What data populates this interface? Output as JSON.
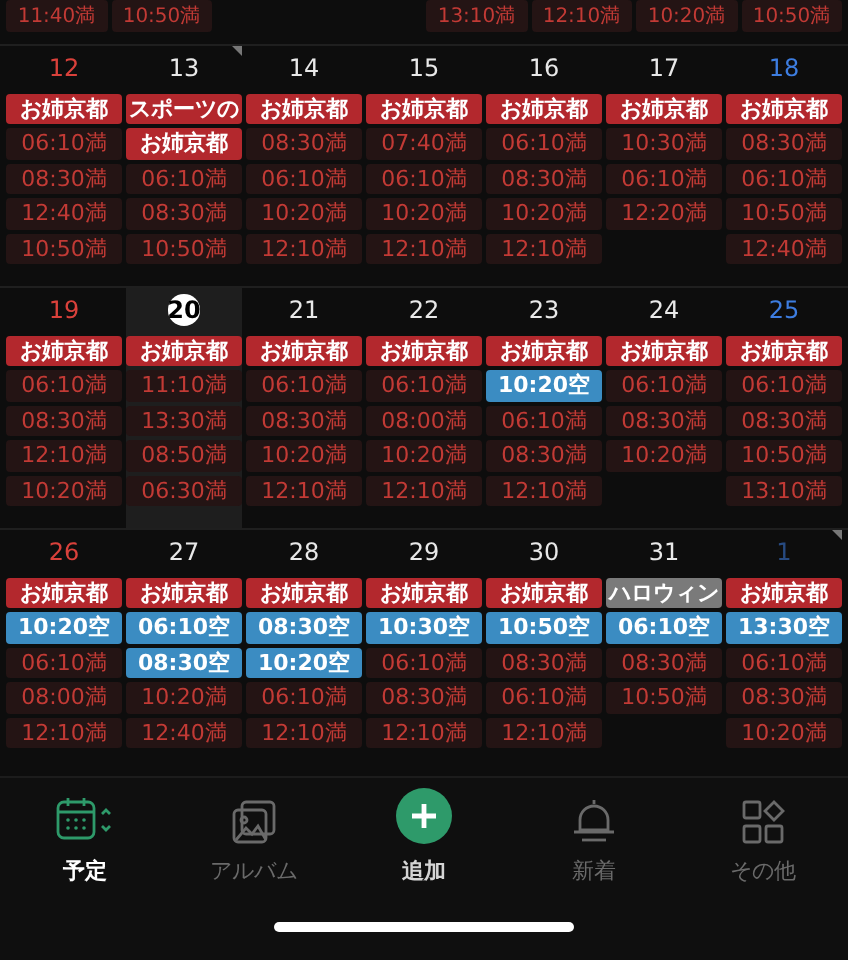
{
  "partial_row": [
    {
      "kind": "full",
      "text": "11:40満"
    },
    {
      "kind": "full",
      "text": "10:50満"
    },
    {
      "kind": "blank"
    },
    {
      "kind": "blank"
    },
    {
      "kind": "full",
      "text": "13:10満"
    },
    {
      "kind": "full",
      "text": "12:10満"
    },
    {
      "kind": "full",
      "text": "10:20満"
    },
    {
      "kind": "full",
      "text": "10:50満"
    }
  ],
  "weeks": [
    {
      "days": [
        {
          "day": "12",
          "kind": "sun",
          "today": false,
          "marked": false,
          "other_month": false,
          "chips": [
            {
              "kind": "event",
              "text": "お姉京都"
            },
            {
              "kind": "full",
              "text": "06:10満"
            },
            {
              "kind": "full",
              "text": "08:30満"
            },
            {
              "kind": "full",
              "text": "12:40満"
            },
            {
              "kind": "full",
              "text": "10:50満"
            }
          ]
        },
        {
          "day": "13",
          "kind": "weekday",
          "today": false,
          "marked": true,
          "other_month": false,
          "chips": [
            {
              "kind": "event",
              "text": "スポーツの"
            },
            {
              "kind": "event",
              "text": "お姉京都"
            },
            {
              "kind": "full",
              "text": "06:10満"
            },
            {
              "kind": "full",
              "text": "08:30満"
            },
            {
              "kind": "full",
              "text": "10:50満"
            }
          ]
        },
        {
          "day": "14",
          "kind": "weekday",
          "today": false,
          "marked": false,
          "other_month": false,
          "chips": [
            {
              "kind": "event",
              "text": "お姉京都"
            },
            {
              "kind": "full",
              "text": "08:30満"
            },
            {
              "kind": "full",
              "text": "06:10満"
            },
            {
              "kind": "full",
              "text": "10:20満"
            },
            {
              "kind": "full",
              "text": "12:10満"
            }
          ]
        },
        {
          "day": "15",
          "kind": "weekday",
          "today": false,
          "marked": false,
          "other_month": false,
          "chips": [
            {
              "kind": "event",
              "text": "お姉京都"
            },
            {
              "kind": "full",
              "text": "07:40満"
            },
            {
              "kind": "full",
              "text": "06:10満"
            },
            {
              "kind": "full",
              "text": "10:20満"
            },
            {
              "kind": "full",
              "text": "12:10満"
            }
          ]
        },
        {
          "day": "16",
          "kind": "weekday",
          "today": false,
          "marked": false,
          "other_month": false,
          "chips": [
            {
              "kind": "event",
              "text": "お姉京都"
            },
            {
              "kind": "full",
              "text": "06:10満"
            },
            {
              "kind": "full",
              "text": "08:30満"
            },
            {
              "kind": "full",
              "text": "10:20満"
            },
            {
              "kind": "full",
              "text": "12:10満"
            }
          ]
        },
        {
          "day": "17",
          "kind": "weekday",
          "today": false,
          "marked": false,
          "other_month": false,
          "chips": [
            {
              "kind": "event",
              "text": "お姉京都"
            },
            {
              "kind": "full",
              "text": "10:30満"
            },
            {
              "kind": "full",
              "text": "06:10満"
            },
            {
              "kind": "full",
              "text": "12:20満"
            }
          ]
        },
        {
          "day": "18",
          "kind": "sat",
          "today": false,
          "marked": false,
          "other_month": false,
          "chips": [
            {
              "kind": "event",
              "text": "お姉京都"
            },
            {
              "kind": "full",
              "text": "08:30満"
            },
            {
              "kind": "full",
              "text": "06:10満"
            },
            {
              "kind": "full",
              "text": "10:50満"
            },
            {
              "kind": "full",
              "text": "12:40満"
            }
          ]
        }
      ]
    },
    {
      "days": [
        {
          "day": "19",
          "kind": "sun",
          "today": false,
          "marked": false,
          "other_month": false,
          "chips": [
            {
              "kind": "event",
              "text": "お姉京都"
            },
            {
              "kind": "full",
              "text": "06:10満"
            },
            {
              "kind": "full",
              "text": "08:30満"
            },
            {
              "kind": "full",
              "text": "12:10満"
            },
            {
              "kind": "full",
              "text": "10:20満"
            }
          ]
        },
        {
          "day": "20",
          "kind": "weekday",
          "today": true,
          "marked": false,
          "other_month": false,
          "chips": [
            {
              "kind": "event",
              "text": "お姉京都"
            },
            {
              "kind": "full",
              "text": "11:10満"
            },
            {
              "kind": "full",
              "text": "13:30満"
            },
            {
              "kind": "full",
              "text": "08:50満"
            },
            {
              "kind": "full",
              "text": "06:30満"
            }
          ]
        },
        {
          "day": "21",
          "kind": "weekday",
          "today": false,
          "marked": false,
          "other_month": false,
          "chips": [
            {
              "kind": "event",
              "text": "お姉京都"
            },
            {
              "kind": "full",
              "text": "06:10満"
            },
            {
              "kind": "full",
              "text": "08:30満"
            },
            {
              "kind": "full",
              "text": "10:20満"
            },
            {
              "kind": "full",
              "text": "12:10満"
            }
          ]
        },
        {
          "day": "22",
          "kind": "weekday",
          "today": false,
          "marked": false,
          "other_month": false,
          "chips": [
            {
              "kind": "event",
              "text": "お姉京都"
            },
            {
              "kind": "full",
              "text": "06:10満"
            },
            {
              "kind": "full",
              "text": "08:00満"
            },
            {
              "kind": "full",
              "text": "10:20満"
            },
            {
              "kind": "full",
              "text": "12:10満"
            }
          ]
        },
        {
          "day": "23",
          "kind": "weekday",
          "today": false,
          "marked": false,
          "other_month": false,
          "chips": [
            {
              "kind": "event",
              "text": "お姉京都"
            },
            {
              "kind": "vacant",
              "text": "10:20空"
            },
            {
              "kind": "full",
              "text": "06:10満"
            },
            {
              "kind": "full",
              "text": "08:30満"
            },
            {
              "kind": "full",
              "text": "12:10満"
            }
          ]
        },
        {
          "day": "24",
          "kind": "weekday",
          "today": false,
          "marked": false,
          "other_month": false,
          "chips": [
            {
              "kind": "event",
              "text": "お姉京都"
            },
            {
              "kind": "full",
              "text": "06:10満"
            },
            {
              "kind": "full",
              "text": "08:30満"
            },
            {
              "kind": "full",
              "text": "10:20満"
            }
          ]
        },
        {
          "day": "25",
          "kind": "sat",
          "today": false,
          "marked": false,
          "other_month": false,
          "chips": [
            {
              "kind": "event",
              "text": "お姉京都"
            },
            {
              "kind": "full",
              "text": "06:10満"
            },
            {
              "kind": "full",
              "text": "08:30満"
            },
            {
              "kind": "full",
              "text": "10:50満"
            },
            {
              "kind": "full",
              "text": "13:10満"
            }
          ]
        }
      ]
    },
    {
      "days": [
        {
          "day": "26",
          "kind": "sun",
          "today": false,
          "marked": false,
          "other_month": false,
          "chips": [
            {
              "kind": "event",
              "text": "お姉京都"
            },
            {
              "kind": "vacant",
              "text": "10:20空"
            },
            {
              "kind": "full",
              "text": "06:10満"
            },
            {
              "kind": "full",
              "text": "08:00満"
            },
            {
              "kind": "full",
              "text": "12:10満"
            }
          ]
        },
        {
          "day": "27",
          "kind": "weekday",
          "today": false,
          "marked": false,
          "other_month": false,
          "chips": [
            {
              "kind": "event",
              "text": "お姉京都"
            },
            {
              "kind": "vacant",
              "text": "06:10空"
            },
            {
              "kind": "vacant",
              "text": "08:30空"
            },
            {
              "kind": "full",
              "text": "10:20満"
            },
            {
              "kind": "full",
              "text": "12:40満"
            }
          ]
        },
        {
          "day": "28",
          "kind": "weekday",
          "today": false,
          "marked": false,
          "other_month": false,
          "chips": [
            {
              "kind": "event",
              "text": "お姉京都"
            },
            {
              "kind": "vacant",
              "text": "08:30空"
            },
            {
              "kind": "vacant",
              "text": "10:20空"
            },
            {
              "kind": "full",
              "text": "06:10満"
            },
            {
              "kind": "full",
              "text": "12:10満"
            }
          ]
        },
        {
          "day": "29",
          "kind": "weekday",
          "today": false,
          "marked": false,
          "other_month": false,
          "chips": [
            {
              "kind": "event",
              "text": "お姉京都"
            },
            {
              "kind": "vacant",
              "text": "10:30空"
            },
            {
              "kind": "full",
              "text": "06:10満"
            },
            {
              "kind": "full",
              "text": "08:30満"
            },
            {
              "kind": "full",
              "text": "12:10満"
            }
          ]
        },
        {
          "day": "30",
          "kind": "weekday",
          "today": false,
          "marked": false,
          "other_month": false,
          "chips": [
            {
              "kind": "event",
              "text": "お姉京都"
            },
            {
              "kind": "vacant",
              "text": "10:50空"
            },
            {
              "kind": "full",
              "text": "08:30満"
            },
            {
              "kind": "full",
              "text": "06:10満"
            },
            {
              "kind": "full",
              "text": "12:10満"
            }
          ]
        },
        {
          "day": "31",
          "kind": "weekday",
          "today": false,
          "marked": false,
          "other_month": false,
          "chips": [
            {
              "kind": "holiday",
              "text": "ハロウィン"
            },
            {
              "kind": "vacant",
              "text": "06:10空"
            },
            {
              "kind": "full",
              "text": "08:30満"
            },
            {
              "kind": "full",
              "text": "10:50満"
            }
          ]
        },
        {
          "day": "1",
          "kind": "sat",
          "today": false,
          "marked": true,
          "other_month": true,
          "chips": [
            {
              "kind": "event",
              "text": "お姉京都"
            },
            {
              "kind": "vacant",
              "text": "13:30空"
            },
            {
              "kind": "full",
              "text": "06:10満"
            },
            {
              "kind": "full",
              "text": "08:30満"
            },
            {
              "kind": "full",
              "text": "10:20満"
            }
          ]
        }
      ]
    }
  ],
  "tabs": [
    {
      "kind": "calendar",
      "label": "予定",
      "selected": true
    },
    {
      "kind": "album",
      "label": "アルバム",
      "selected": false
    },
    {
      "kind": "add",
      "label": "追加",
      "selected": false
    },
    {
      "kind": "bell",
      "label": "新着",
      "selected": false
    },
    {
      "kind": "more",
      "label": "その他",
      "selected": false
    }
  ]
}
